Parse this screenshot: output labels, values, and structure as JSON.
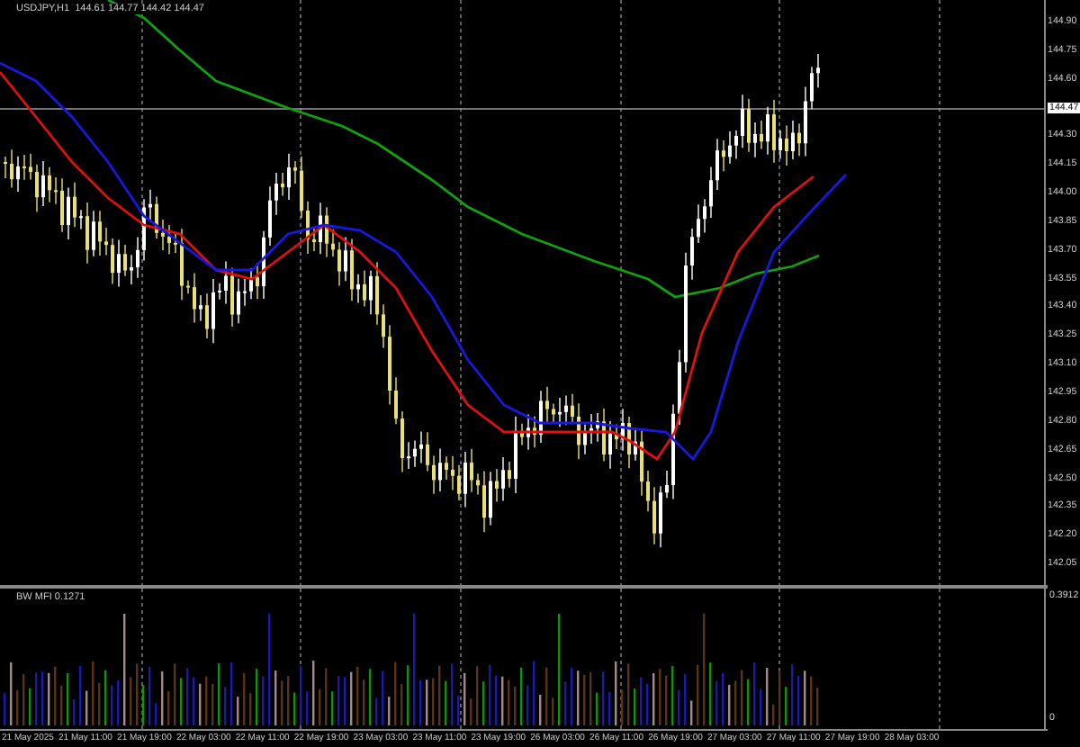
{
  "chart_title": {
    "symbol": "USDJPY,H1",
    "quote": [
      "144.61",
      "144.77",
      "144.42",
      "144.47"
    ]
  },
  "price_axis": [
    {
      "label": "144.90",
      "kind": "tick"
    },
    {
      "label": "144.75",
      "kind": "tick"
    },
    {
      "label": "144.60",
      "kind": "tick"
    },
    {
      "label": "144.47",
      "kind": "current"
    },
    {
      "label": "144.30",
      "kind": "tick"
    },
    {
      "label": "144.15",
      "kind": "tick"
    },
    {
      "label": "144.00",
      "kind": "tick"
    },
    {
      "label": "143.85",
      "kind": "tick"
    },
    {
      "label": "143.70",
      "kind": "tick"
    },
    {
      "label": "143.55",
      "kind": "tick"
    },
    {
      "label": "143.40",
      "kind": "tick"
    },
    {
      "label": "143.25",
      "kind": "tick"
    },
    {
      "label": "143.10",
      "kind": "tick"
    },
    {
      "label": "142.95",
      "kind": "tick"
    },
    {
      "label": "142.80",
      "kind": "tick"
    },
    {
      "label": "142.65",
      "kind": "tick"
    },
    {
      "label": "142.50",
      "kind": "tick"
    },
    {
      "label": "142.35",
      "kind": "tick"
    },
    {
      "label": "142.20",
      "kind": "tick"
    },
    {
      "label": "142.05",
      "kind": "tick"
    }
  ],
  "indicator": {
    "label": "BW MFI 0.1271",
    "axis": [
      "0.3912",
      "0"
    ]
  },
  "time_axis": [
    "21 May 2025",
    "21 May 11:00",
    "21 May 19:00",
    "22 May 03:00",
    "22 May 11:00",
    "22 May 19:00",
    "23 May 03:00",
    "23 May 11:00",
    "23 May 19:00",
    "26 May 03:00",
    "26 May 11:00",
    "26 May 19:00",
    "27 May 03:00",
    "27 May 11:00",
    "27 May 19:00",
    "28 May 03:00"
  ]
}
